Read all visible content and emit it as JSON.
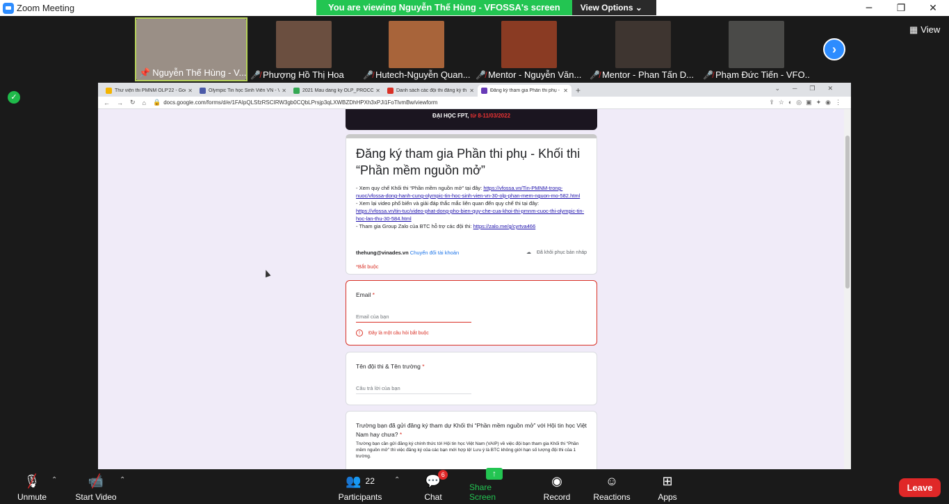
{
  "app": {
    "title": "Zoom Meeting"
  },
  "share_banner": {
    "text": "You are viewing Nguyễn Thế Hùng - VFOSSA's screen",
    "view_options": "View Options ⌄"
  },
  "view_label": "View",
  "participants": [
    {
      "name": "Nguyễn Thế Hùng - V...",
      "muted": false,
      "active": true,
      "color": "#9a8f86"
    },
    {
      "name": "Phượng Hồ Thị Hoa",
      "muted": true,
      "active": false,
      "color": "#6b4f40"
    },
    {
      "name": "Hutech-Nguyễn Quan...",
      "muted": true,
      "active": false,
      "color": "#a8643a"
    },
    {
      "name": "Mentor - Nguyễn Văn...",
      "muted": true,
      "active": false,
      "color": "#8a3b23"
    },
    {
      "name": "Mentor - Phan Tấn D...",
      "muted": true,
      "active": false,
      "color": "#3e3530"
    },
    {
      "name": "Phạm Đức Tiến - VFO...",
      "muted": true,
      "active": false,
      "color": "#4a4a48"
    }
  ],
  "browser": {
    "tabs": [
      {
        "label": "Thư viện thi PMNM OLP'22 - Goo",
        "color": "#f4b400"
      },
      {
        "label": "Olympic Tin học Sinh Viên VN - V",
        "color": "#4b5aa8"
      },
      {
        "label": "2021 Mau dang ky OLP_PROCON",
        "color": "#34a853"
      },
      {
        "label": "Danh sách các đội thi đăng ký th",
        "color": "#d93025"
      },
      {
        "label": "Đăng ký tham gia Phần thi phụ - K",
        "color": "#673ab7"
      }
    ],
    "url": "docs.google.com/forms/d/e/1FAIpQLSfzRSCIRW3gb0CQbLPrsjp3qLXWBZDhHPXh3xPJi1FoTlvmBw/viewform"
  },
  "form": {
    "banner_text": "ĐẠI HỌC FPT,",
    "banner_date": "từ 8-11/03/2022",
    "title": "Đăng ký tham gia Phần thi phụ - Khối thi “Phần mềm nguồn mở”",
    "desc1": "- Xem quy chế Khối thi “Phần mềm nguồn mở”  tại đây: ",
    "link1": "https://vfossa.vn/Tin-PMNM-trong-nuoc/vfossa-dong-hanh-cung-olympic-tin-hoc-sinh-vien-vn-30-olp-phan-mem-nguon-mo-582.html",
    "desc2": "- Xem lại video phổ biến và giải đáp thắc mắc liên quan đến quy chế thi tại đây:",
    "link2": "https://vfossa.vn/tin-tuc/video-phat-dong-pho-bien-quy-che-cua-khoi-thi-pmnm-cuoc-thi-olympic-tin-hoc-lan-thu-30-584.html",
    "desc3": "- Tham gia Group Zalo của BTC hỗ trợ các đội thi: ",
    "link3": "https://zalo.me/g/cyrtva466",
    "account": "thehung@vinades.vn",
    "switch_account": "Chuyển đổi tài khoản",
    "draft": "Đã khôi phục bản nháp",
    "required_note": "*Bắt buộc",
    "q1_label": "Email",
    "q1_placeholder": "Email của bạn",
    "q1_error": "Đây là một câu hỏi bắt buộc",
    "q2_label": "Tên đội thi & Tên trường",
    "q2_placeholder": "Câu trả lời của bạn",
    "q3_label": "Trường bạn đã gửi đăng ký tham dự Khối thi “Phần mềm nguồn mở” với Hội tin học Việt Nam hay chưa?",
    "q3_sub": "Trường bạn cần gửi đăng ký chính thức tới Hội tin học Việt Nam (VAIP) về việc đội bạn tham gia Khối thi “Phần mềm nguồn mở” thì việc đăng ký của các bạn mới hợp lệ! Lưu ý là BTC không giới hạn số lượng đội thi của 1 trường."
  },
  "toolbar": {
    "unmute": "Unmute",
    "start_video": "Start Video",
    "participants": "Participants",
    "participants_count": "22",
    "chat": "Chat",
    "chat_badge": "6",
    "share_screen": "Share Screen",
    "record": "Record",
    "reactions": "Reactions",
    "apps": "Apps",
    "leave": "Leave"
  }
}
